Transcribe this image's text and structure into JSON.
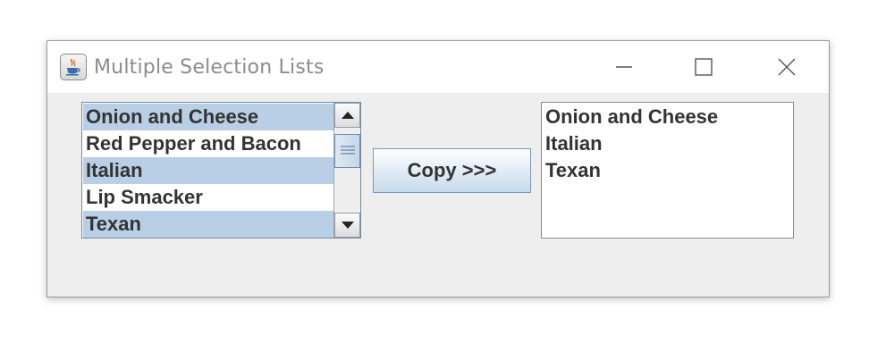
{
  "window": {
    "title": "Multiple Selection Lists",
    "icon": "java-cup-icon",
    "controls": [
      "minimize-icon",
      "maximize-icon",
      "close-icon"
    ]
  },
  "left_list": {
    "items": [
      {
        "label": "Onion and Cheese",
        "selected": true
      },
      {
        "label": "Red Pepper and Bacon",
        "selected": false
      },
      {
        "label": "Italian",
        "selected": true
      },
      {
        "label": "Lip Smacker",
        "selected": false
      },
      {
        "label": "Texan",
        "selected": true
      }
    ]
  },
  "copy_button": {
    "label": "Copy >>>"
  },
  "right_list": {
    "items": [
      {
        "label": "Onion and Cheese"
      },
      {
        "label": "Italian"
      },
      {
        "label": "Texan"
      }
    ]
  },
  "colors": {
    "selection": "#b8cfe5",
    "window_bg": "#eeeeee"
  }
}
